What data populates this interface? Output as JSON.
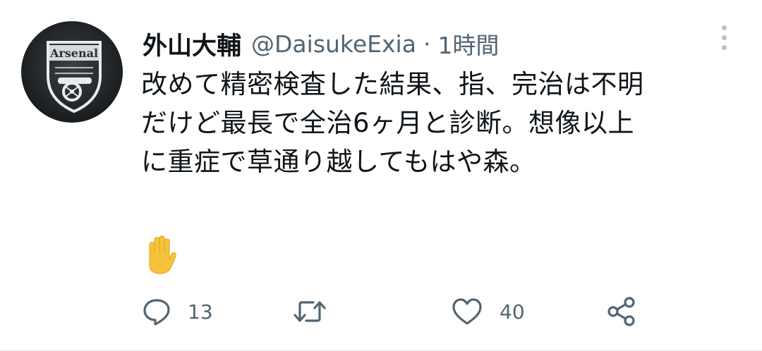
{
  "tweet": {
    "avatar_text": "Arsenal",
    "display_name": "外山大輔",
    "handle": "@DaisukeExia",
    "separator": "·",
    "timestamp": "1時間",
    "text_lines": [
      "改めて精密検査した結果、指、完治は不明",
      "だけど最長で全治6ヶ月と診断。想像以上",
      "に重症で草通り越してもはや森。"
    ],
    "emoji": "raised-hand",
    "actions": {
      "reply_count": "13",
      "retweet_count": "",
      "like_count": "40"
    }
  },
  "colors": {
    "text": "#0f1419",
    "secondary": "#536471",
    "emoji_yellow": "#f5c33b",
    "divider": "#eff3f4"
  }
}
